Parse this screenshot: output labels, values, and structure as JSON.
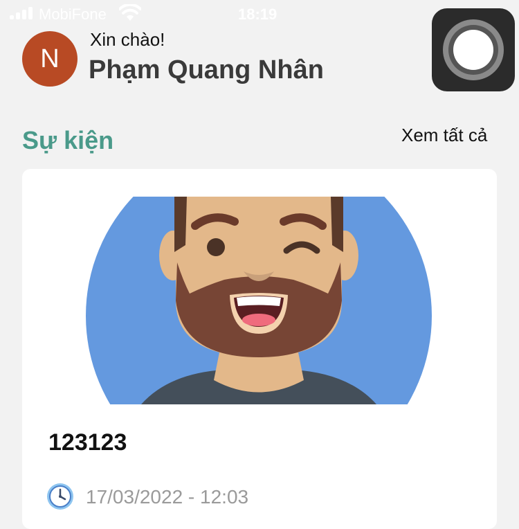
{
  "status_bar": {
    "carrier": "MobiFone",
    "time": "18:19",
    "right_text": "",
    "icons": [
      "signal-icon",
      "wifi-icon"
    ]
  },
  "header": {
    "avatar_initial": "N",
    "avatar_color": "#b84a24",
    "greeting": "Xin chào!",
    "user_name": "Phạm Quang Nhân"
  },
  "events": {
    "section_title": "Sự kiện",
    "see_all_label": "Xem tất cả",
    "accent_color": "#4a9a8a",
    "items": [
      {
        "title": "123123",
        "datetime": "17/03/2022 - 12:03",
        "image": "winking-bearded-man-avatar"
      }
    ]
  }
}
